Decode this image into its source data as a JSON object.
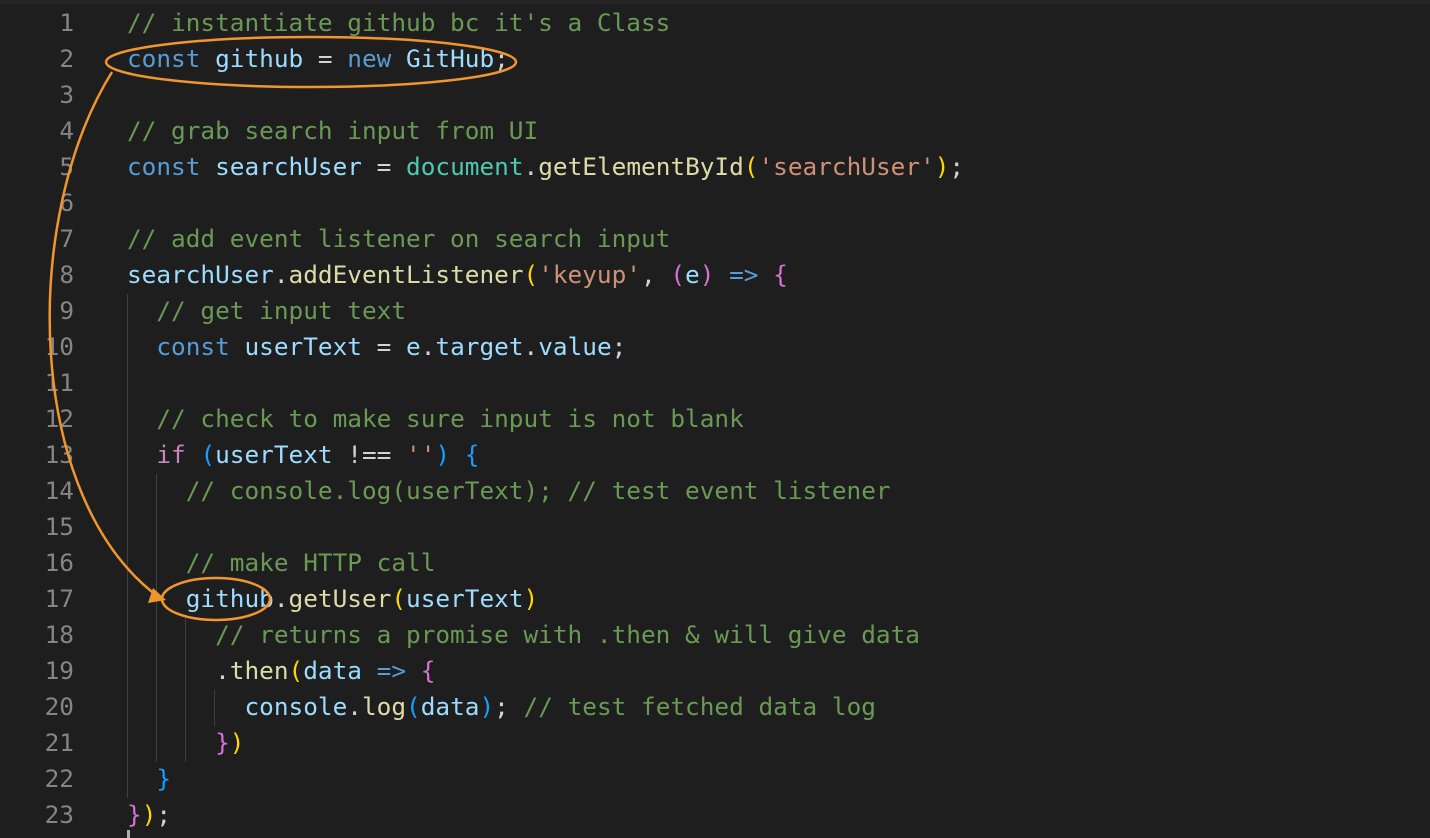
{
  "editor": {
    "language": "javascript",
    "theme_colors": {
      "background": "#1e1e1e",
      "comment": "#6a9955",
      "keyword": "#569cd6",
      "variable": "#9cdcfe",
      "string": "#ce9178",
      "function": "#dcdcaa",
      "annotation": "#f0962e"
    },
    "lines": [
      {
        "number": "1",
        "tokens": [
          {
            "t": "comment",
            "v": "// instantiate github bc it's a Class"
          }
        ]
      },
      {
        "number": "2",
        "tokens": [
          {
            "t": "keyword",
            "v": "const"
          },
          {
            "t": "punct",
            "v": " "
          },
          {
            "t": "var",
            "v": "github"
          },
          {
            "t": "punct",
            "v": " = "
          },
          {
            "t": "keyword",
            "v": "new"
          },
          {
            "t": "punct",
            "v": " "
          },
          {
            "t": "var",
            "v": "GitHub"
          },
          {
            "t": "punct",
            "v": ";"
          }
        ]
      },
      {
        "number": "3",
        "tokens": []
      },
      {
        "number": "4",
        "tokens": [
          {
            "t": "comment",
            "v": "// grab search input from UI"
          }
        ]
      },
      {
        "number": "5",
        "tokens": [
          {
            "t": "keyword",
            "v": "const"
          },
          {
            "t": "punct",
            "v": " "
          },
          {
            "t": "var",
            "v": "searchUser"
          },
          {
            "t": "punct",
            "v": " = "
          },
          {
            "t": "class",
            "v": "document"
          },
          {
            "t": "punct",
            "v": "."
          },
          {
            "t": "func",
            "v": "getElementById"
          },
          {
            "t": "b1",
            "v": "("
          },
          {
            "t": "string",
            "v": "'searchUser'"
          },
          {
            "t": "b1",
            "v": ")"
          },
          {
            "t": "punct",
            "v": ";"
          }
        ]
      },
      {
        "number": "6",
        "tokens": []
      },
      {
        "number": "7",
        "tokens": [
          {
            "t": "comment",
            "v": "// add event listener on search input"
          }
        ]
      },
      {
        "number": "8",
        "tokens": [
          {
            "t": "var",
            "v": "searchUser"
          },
          {
            "t": "punct",
            "v": "."
          },
          {
            "t": "func",
            "v": "addEventListener"
          },
          {
            "t": "b1",
            "v": "("
          },
          {
            "t": "string",
            "v": "'keyup'"
          },
          {
            "t": "punct",
            "v": ", "
          },
          {
            "t": "b2",
            "v": "("
          },
          {
            "t": "param",
            "v": "e"
          },
          {
            "t": "b2",
            "v": ")"
          },
          {
            "t": "punct",
            "v": " "
          },
          {
            "t": "keyword",
            "v": "=>"
          },
          {
            "t": "punct",
            "v": " "
          },
          {
            "t": "b2",
            "v": "{"
          }
        ]
      },
      {
        "number": "9",
        "tokens": [
          {
            "t": "punct",
            "v": "  "
          },
          {
            "t": "comment",
            "v": "// get input text"
          }
        ]
      },
      {
        "number": "10",
        "tokens": [
          {
            "t": "punct",
            "v": "  "
          },
          {
            "t": "keyword",
            "v": "const"
          },
          {
            "t": "punct",
            "v": " "
          },
          {
            "t": "var",
            "v": "userText"
          },
          {
            "t": "punct",
            "v": " = "
          },
          {
            "t": "var",
            "v": "e"
          },
          {
            "t": "punct",
            "v": "."
          },
          {
            "t": "var",
            "v": "target"
          },
          {
            "t": "punct",
            "v": "."
          },
          {
            "t": "var",
            "v": "value"
          },
          {
            "t": "punct",
            "v": ";"
          }
        ]
      },
      {
        "number": "11",
        "tokens": []
      },
      {
        "number": "12",
        "tokens": [
          {
            "t": "punct",
            "v": "  "
          },
          {
            "t": "comment",
            "v": "// check to make sure input is not blank"
          }
        ]
      },
      {
        "number": "13",
        "tokens": [
          {
            "t": "punct",
            "v": "  "
          },
          {
            "t": "control",
            "v": "if"
          },
          {
            "t": "punct",
            "v": " "
          },
          {
            "t": "b3",
            "v": "("
          },
          {
            "t": "var",
            "v": "userText"
          },
          {
            "t": "punct",
            "v": " !== "
          },
          {
            "t": "string",
            "v": "''"
          },
          {
            "t": "b3",
            "v": ")"
          },
          {
            "t": "punct",
            "v": " "
          },
          {
            "t": "b3",
            "v": "{"
          }
        ]
      },
      {
        "number": "14",
        "tokens": [
          {
            "t": "punct",
            "v": "    "
          },
          {
            "t": "comment",
            "v": "// console.log(userText); // test event listener"
          }
        ]
      },
      {
        "number": "15",
        "tokens": []
      },
      {
        "number": "16",
        "tokens": [
          {
            "t": "punct",
            "v": "    "
          },
          {
            "t": "comment",
            "v": "// make HTTP call"
          }
        ]
      },
      {
        "number": "17",
        "tokens": [
          {
            "t": "punct",
            "v": "    "
          },
          {
            "t": "var",
            "v": "github"
          },
          {
            "t": "punct",
            "v": "."
          },
          {
            "t": "func",
            "v": "getUser"
          },
          {
            "t": "b1",
            "v": "("
          },
          {
            "t": "var",
            "v": "userText"
          },
          {
            "t": "b1",
            "v": ")"
          }
        ]
      },
      {
        "number": "18",
        "tokens": [
          {
            "t": "punct",
            "v": "      "
          },
          {
            "t": "comment",
            "v": "// returns a promise with .then & will give data"
          }
        ]
      },
      {
        "number": "19",
        "tokens": [
          {
            "t": "punct",
            "v": "      ."
          },
          {
            "t": "func",
            "v": "then"
          },
          {
            "t": "b1",
            "v": "("
          },
          {
            "t": "param",
            "v": "data"
          },
          {
            "t": "punct",
            "v": " "
          },
          {
            "t": "keyword",
            "v": "=>"
          },
          {
            "t": "punct",
            "v": " "
          },
          {
            "t": "b2",
            "v": "{"
          }
        ]
      },
      {
        "number": "20",
        "tokens": [
          {
            "t": "punct",
            "v": "        "
          },
          {
            "t": "var",
            "v": "console"
          },
          {
            "t": "punct",
            "v": "."
          },
          {
            "t": "func",
            "v": "log"
          },
          {
            "t": "b3",
            "v": "("
          },
          {
            "t": "var",
            "v": "data"
          },
          {
            "t": "b3",
            "v": ")"
          },
          {
            "t": "punct",
            "v": "; "
          },
          {
            "t": "comment",
            "v": "// test fetched data log"
          }
        ]
      },
      {
        "number": "21",
        "tokens": [
          {
            "t": "punct",
            "v": "      "
          },
          {
            "t": "b2",
            "v": "}"
          },
          {
            "t": "b1",
            "v": ")"
          }
        ]
      },
      {
        "number": "22",
        "tokens": [
          {
            "t": "punct",
            "v": "  "
          },
          {
            "t": "b3",
            "v": "}"
          }
        ]
      },
      {
        "number": "23",
        "tokens": [
          {
            "t": "b2",
            "v": "}"
          },
          {
            "t": "b1",
            "v": ")"
          },
          {
            "t": "punct",
            "v": ";"
          }
        ]
      }
    ]
  }
}
